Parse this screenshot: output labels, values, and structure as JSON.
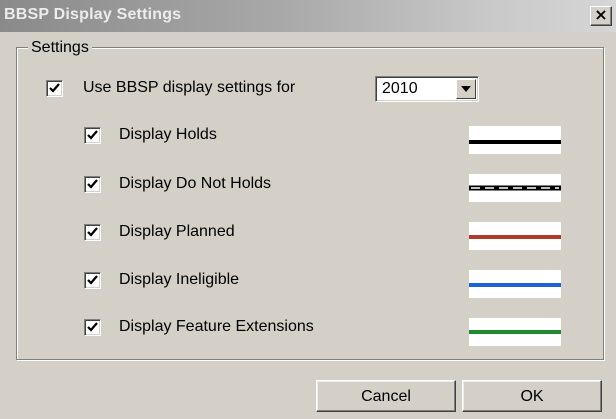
{
  "window": {
    "title": "BBSP Display Settings",
    "close_symbol": "×",
    "close_icon": "close-icon"
  },
  "settings_group": {
    "label": "Settings",
    "use_settings": {
      "label": "Use BBSP display settings for",
      "checked": true
    },
    "year_select": {
      "value": "2010",
      "arrow_icon": "chevron-down-icon"
    },
    "options": [
      {
        "label": "Display Holds",
        "checked": true,
        "line_style": "solid",
        "line_color": "#000000"
      },
      {
        "label": "Display Do Not Holds",
        "checked": true,
        "line_style": "dashed",
        "line_color": "#000000"
      },
      {
        "label": "Display Planned",
        "checked": true,
        "line_style": "solid",
        "line_color": "#b03a2e"
      },
      {
        "label": "Display Ineligible",
        "checked": true,
        "line_style": "solid",
        "line_color": "#1f62d8"
      },
      {
        "label": "Display Feature Extensions",
        "checked": true,
        "line_style": "solid",
        "line_color": "#1e8a2c"
      }
    ]
  },
  "buttons": {
    "cancel_label": "Cancel",
    "ok_label": "OK"
  },
  "colors": {
    "dialog_background": "#d4d0c8",
    "checkmark": "#000000"
  }
}
